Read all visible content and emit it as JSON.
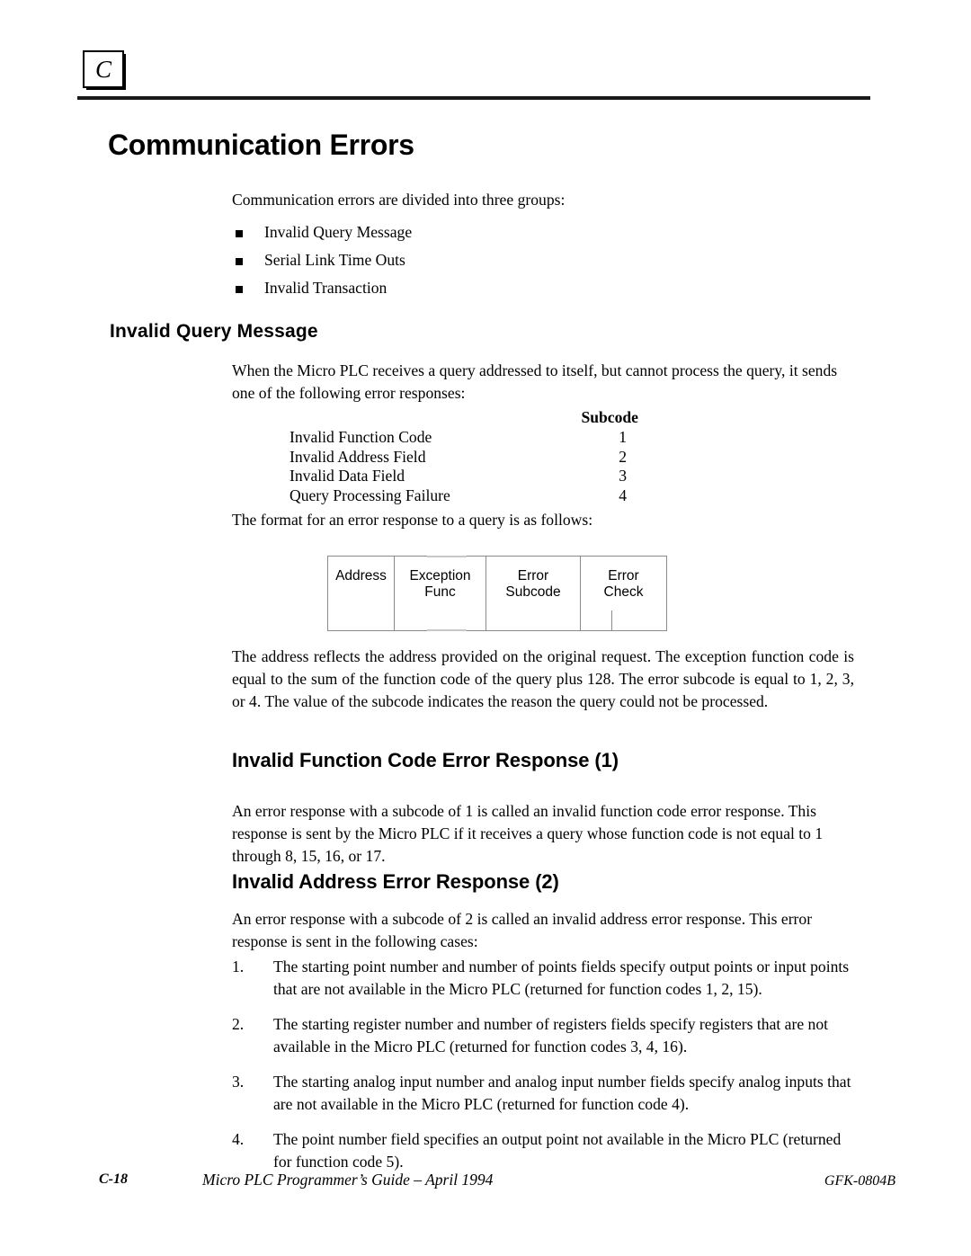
{
  "chapter_marker": "C",
  "page_title": "Communication Errors",
  "intro": {
    "lead": "Communication errors are divided into three groups:",
    "bullets": [
      "Invalid Query Message",
      "Serial Link Time Outs",
      "Invalid Transaction"
    ]
  },
  "sections": {
    "invalid_query_message": {
      "heading": "Invalid Query Message",
      "paragraph": "When the Micro PLC receives a query addressed to itself, but cannot process the query, it sends one of the following error responses:",
      "table": {
        "value_header": "Subcode",
        "rows": [
          {
            "name": "Invalid Function Code",
            "subcode": "1"
          },
          {
            "name": "Invalid Address Field",
            "subcode": "2"
          },
          {
            "name": "Invalid Data Field",
            "subcode": "3"
          },
          {
            "name": "Query Processing Failure",
            "subcode": "4"
          }
        ]
      },
      "format_intro": "The format for an error response to a query is as follows:",
      "frame_diagram": {
        "cells": [
          "Address",
          "Exception\nFunc",
          "Error\nSubcode",
          "Error\nCheck"
        ],
        "cell_1": "Address",
        "cell_2_line1": "Exception",
        "cell_2_line2": "Func",
        "cell_3_line1": "Error",
        "cell_3_line2": "Subcode",
        "cell_4_line1": "Error",
        "cell_4_line2": "Check"
      },
      "explanation": "The address reflects the address provided on the original request.  The exception function code is equal to the sum of the function code of the query plus 128.  The error subcode is equal to 1, 2, 3, or 4.  The value of the subcode indicates the reason the query could not be processed."
    },
    "invalid_function_code": {
      "heading": "Invalid Function Code Error Response  (1)",
      "paragraph": "An error response with a subcode of 1 is called an invalid function code error response. This response is sent by the Micro PLC if it receives a query whose function code is not equal to 1 through 8, 15, 16, or 17."
    },
    "invalid_address": {
      "heading": "Invalid Address Error Response  (2)",
      "paragraph": "An error response with a subcode of 2 is called an invalid address error response.  This error response is sent in the following cases:",
      "cases": [
        {
          "number": "1.",
          "text": "The starting point number and number of points fields specify output points or input points that are not available in the Micro PLC (returned for function codes 1, 2, 15)."
        },
        {
          "number": "2.",
          "text": "The starting register number and number of registers fields specify registers that are not available in the Micro PLC (returned for function codes 3, 4, 16)."
        },
        {
          "number": "3.",
          "text": "The starting analog input number and analog input number fields specify analog inputs that are not available in the Micro PLC (returned for function code 4)."
        },
        {
          "number": "4.",
          "text": "The point number field specifies an output point not available in the Micro PLC (returned for function code 5)."
        }
      ]
    }
  },
  "footer": {
    "page_number": "C-18",
    "document_title": "Micro PLC Programmer’s Guide – April 1994",
    "doc_code": "GFK-0804B"
  }
}
